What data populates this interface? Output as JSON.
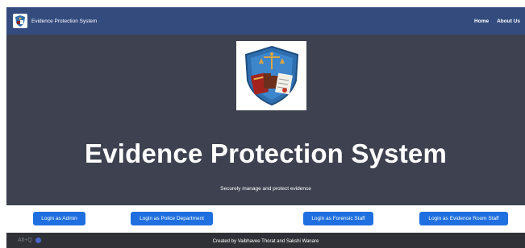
{
  "navbar": {
    "title": "Evidence Protection System",
    "links": [
      "Home",
      "About Us"
    ]
  },
  "hero": {
    "title": "Evidence Protection System",
    "subtitle": "Securely manage and protect evidence"
  },
  "buttons": [
    "Login as Admin",
    "Login as Police Department",
    "Login as Forensic Staff",
    "Login as Evidence Room Staff"
  ],
  "footer": {
    "shortcut": "Alt+Q",
    "credit": "Created by Vaibhavee Thorat and Sakshi Wanare"
  },
  "colors": {
    "navbar": "#344b7e",
    "hero": "#3e4250",
    "button": "#1f6fe0",
    "footer": "#2f3136"
  }
}
